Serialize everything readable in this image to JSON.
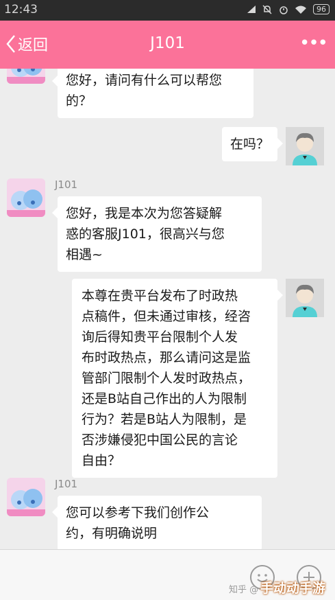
{
  "status_bar": {
    "time": "12:43",
    "battery": "96"
  },
  "header": {
    "back_label": "返回",
    "title": "J101"
  },
  "messages": [
    {
      "side": "left",
      "sender": "",
      "lines": [
        "您好，请问有什么可以帮您",
        "的？"
      ]
    },
    {
      "side": "right",
      "lines": [
        "在吗？"
      ]
    },
    {
      "side": "left",
      "sender": "J101",
      "lines": [
        "您好，我是本次为您答疑解",
        "惑的客服J101，很高兴与您",
        "相遇~"
      ]
    },
    {
      "side": "right",
      "lines": [
        "本尊在贵平台发布了时政热",
        "点稿件，但未通过审核，经咨",
        "询后得知贵平台限制个人发",
        "布时政热点，那么请问这是监",
        "管部门限制个人发时政热点，",
        "还是B站自己作出的人为限制",
        "行为？若是B站人为限制，是",
        "否涉嫌侵犯中国公民的言论",
        "自由？"
      ]
    },
    {
      "side": "left",
      "sender": "J101",
      "lines": [
        "您可以参考下我们创作公",
        "约，有明确说明"
      ]
    }
  ],
  "watermark": {
    "zhihu": "知乎 @",
    "site": "手动动手游"
  },
  "colors": {
    "header": "#fb7299",
    "status_bar": "#2b2b2b",
    "chat_bg": "#ededed"
  },
  "icons": [
    "back-chevron-icon",
    "more-dots-icon",
    "emoji-icon",
    "plus-icon",
    "wifi-icon",
    "alarm-icon",
    "mute-icon"
  ]
}
